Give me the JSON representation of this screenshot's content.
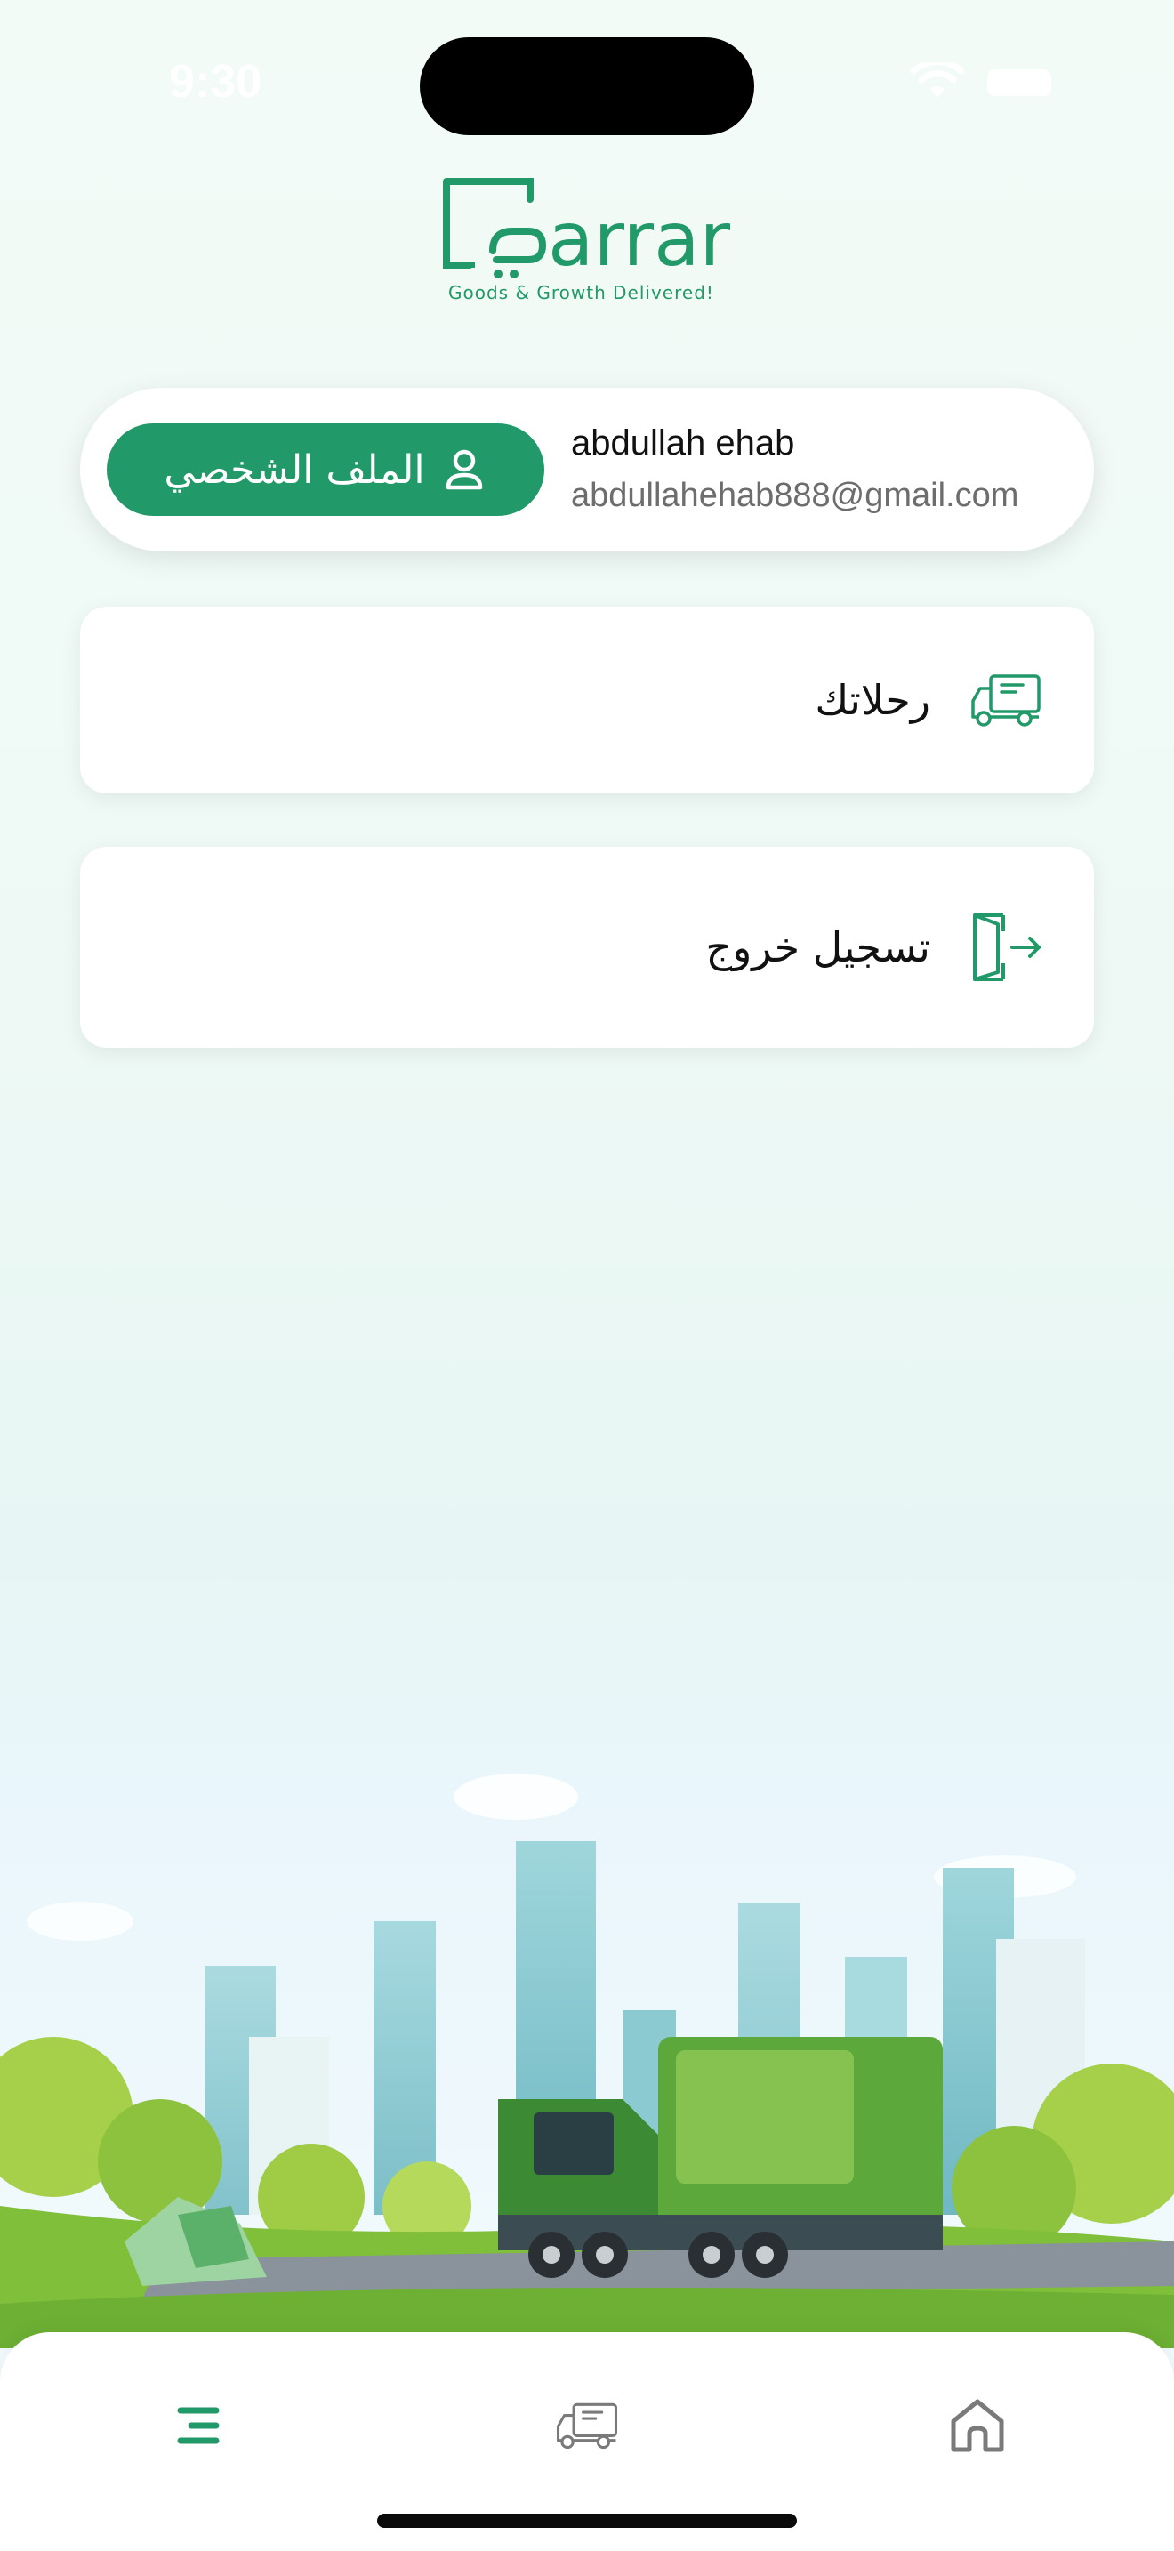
{
  "status_bar": {
    "time": "9:30"
  },
  "logo": {
    "text": "arrar",
    "tagline": "Goods & Growth Delivered!"
  },
  "profile": {
    "button_label": "الملف الشخصي",
    "name": "abdullah ehab",
    "email": "abdullahehab888@gmail.com"
  },
  "menu": {
    "trips_label": "رحلاتك",
    "logout_label": "تسجيل خروج"
  },
  "bottom_nav": {
    "items": [
      {
        "icon": "menu-icon",
        "active": true
      },
      {
        "icon": "truck-icon",
        "active": false
      },
      {
        "icon": "home-icon",
        "active": false
      }
    ]
  },
  "colors": {
    "accent": "#219968",
    "inactive": "#7a7a7a"
  }
}
